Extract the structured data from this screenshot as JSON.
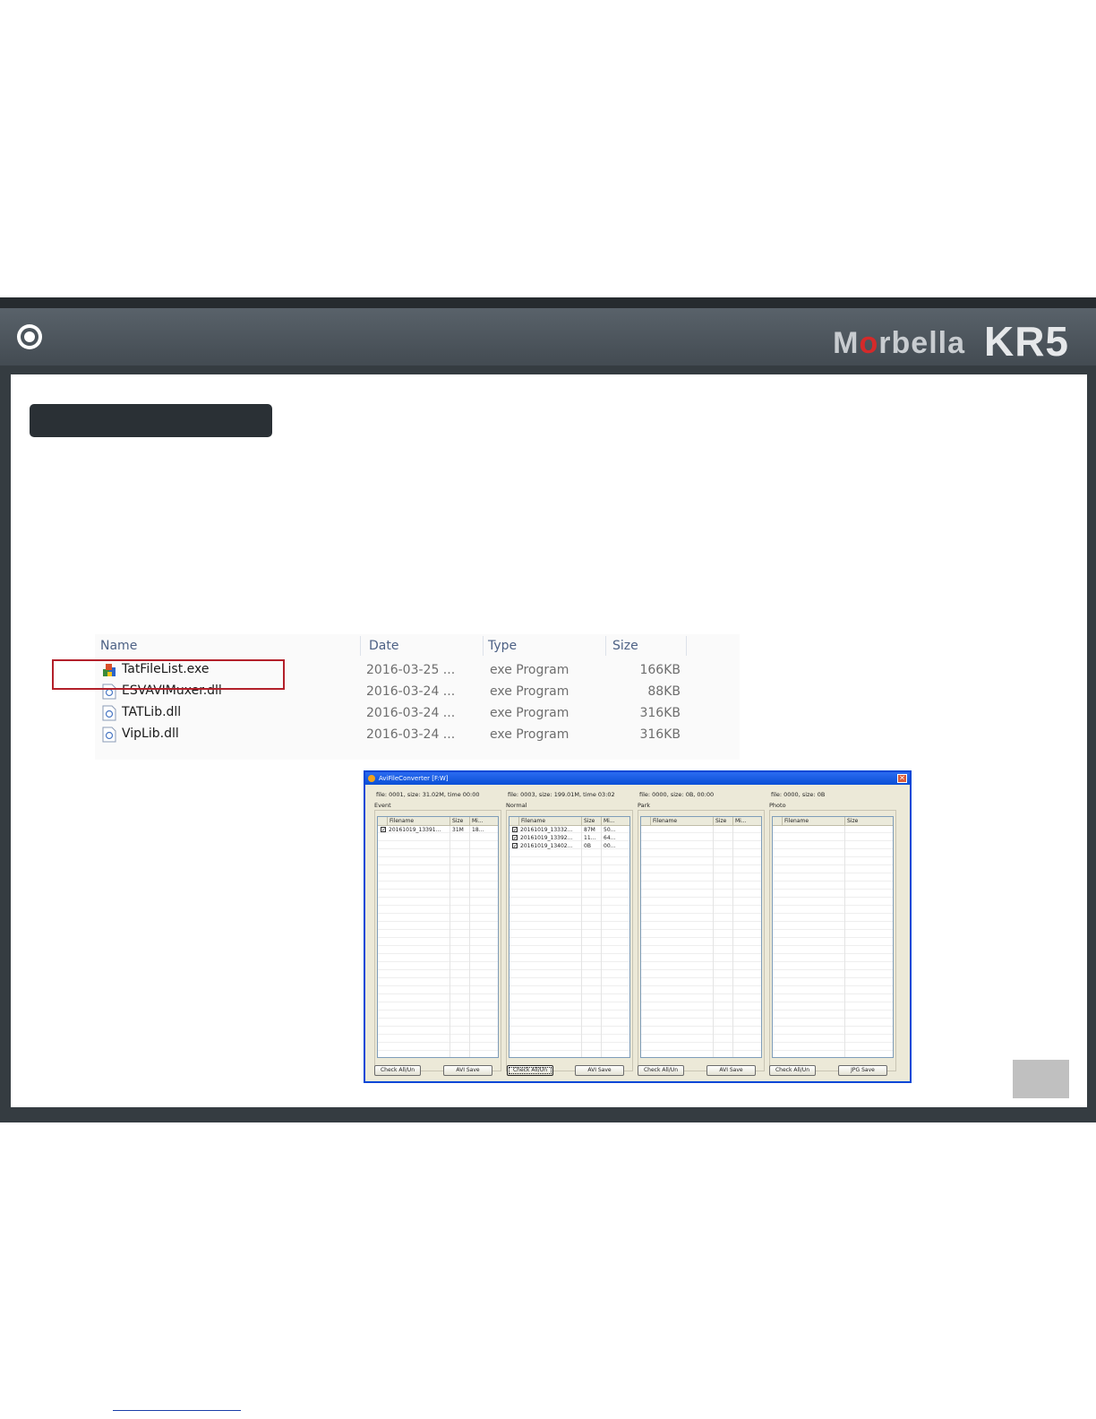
{
  "header": {
    "brand_prefix": "M",
    "brand_dot": "o",
    "brand_suffix": "rbella",
    "model": "KR5",
    "ring_icon": "ring-icon"
  },
  "explorer": {
    "columns": [
      "Name",
      "Date",
      "Type",
      "Size"
    ],
    "rows": [
      {
        "name": "TatFileList.exe",
        "date": "2016-03-25 ...",
        "type": "exe Program",
        "size": "166KB",
        "icon": "exe-app-icon"
      },
      {
        "name": "ESVAVIMuxer.dll",
        "date": "2016-03-24 ...",
        "type": "exe Program",
        "size": "88KB",
        "icon": "dll-file-icon"
      },
      {
        "name": "TATLib.dll",
        "date": "2016-03-24 ...",
        "type": "exe Program",
        "size": "316KB",
        "icon": "dll-file-icon"
      },
      {
        "name": "VipLib.dll",
        "date": "2016-03-24 ...",
        "type": "exe Program",
        "size": "316KB",
        "icon": "dll-file-icon"
      }
    ],
    "highlight_color": "#b3202a"
  },
  "converter": {
    "title": "AviFileConverter  [F:W]",
    "panes": [
      {
        "info": "file: 0001, size: 31.02M, time 00:00",
        "group": "Event",
        "columns": [
          "Filename",
          "Size",
          "Mi..."
        ],
        "rows": [
          {
            "checked": true,
            "filename": "20161019_13391...",
            "size": "31M",
            "mi": "18..."
          }
        ],
        "button_left": "Check All/Un",
        "button_right": "AVI Save"
      },
      {
        "info": "file: 0003, size: 199.01M, time 03:02",
        "group": "Normal",
        "columns": [
          "Filename",
          "Size",
          "Mi..."
        ],
        "rows": [
          {
            "checked": true,
            "filename": "20161019_13332...",
            "size": "87M",
            "mi": "50..."
          },
          {
            "checked": true,
            "filename": "20161019_13392...",
            "size": "11...",
            "mi": "64..."
          },
          {
            "checked": true,
            "filename": "20161019_13402...",
            "size": "0B",
            "mi": "00..."
          }
        ],
        "button_left": "Check All/Un",
        "button_right": "AVI Save"
      },
      {
        "info": "file: 0000, size: 0B, 00:00",
        "group": "Park",
        "columns": [
          "Filename",
          "Size",
          "Mi..."
        ],
        "rows": [],
        "button_left": "Check All/Un",
        "button_right": "AVI Save"
      },
      {
        "info": "file: 0000, size: 0B",
        "group": "Photo",
        "columns": [
          "Filename",
          "Size"
        ],
        "rows": [],
        "button_left": "Check All/Un",
        "button_right": "JPG Save"
      }
    ]
  },
  "colors": {
    "frame": "#353c41",
    "header": "#4c555c",
    "title_pill": "#2a3035",
    "window_border": "#0047d6",
    "window_face": "#ece9d8"
  }
}
